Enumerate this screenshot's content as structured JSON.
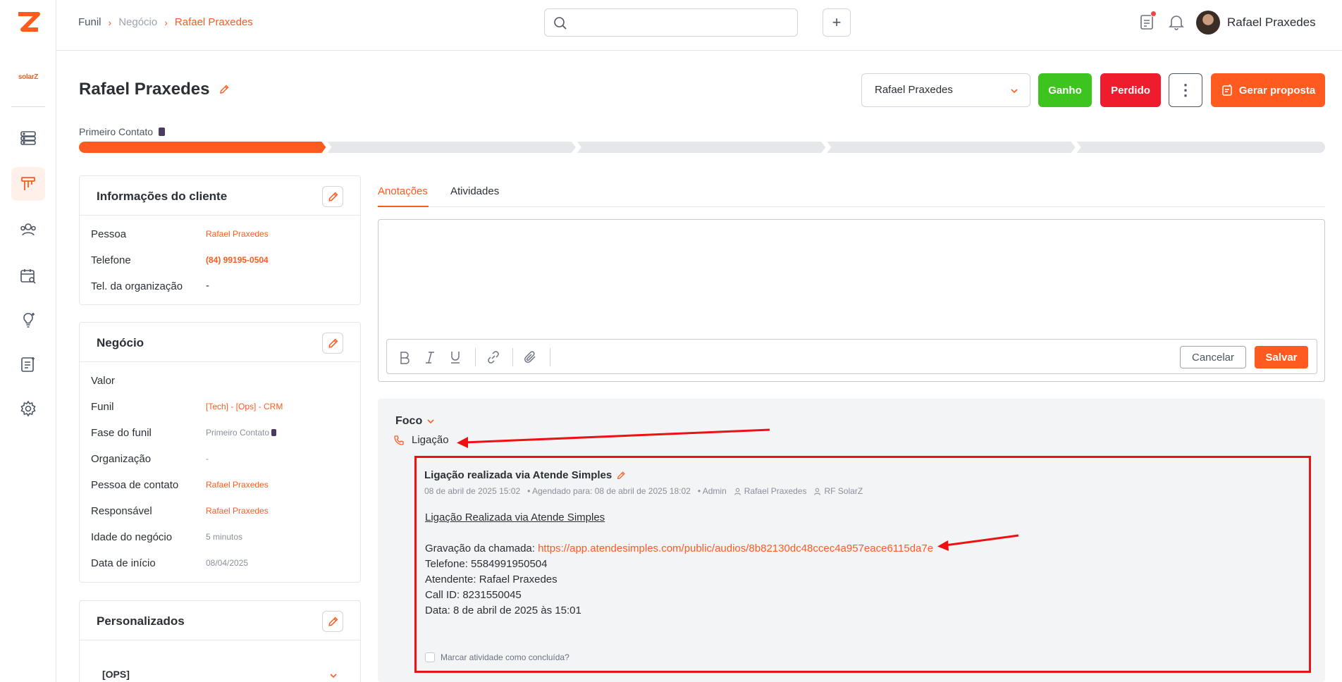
{
  "breadcrumb": {
    "items": [
      "Funil",
      "Negócio"
    ],
    "current": "Rafael Praxedes"
  },
  "search": {
    "placeholder": ""
  },
  "header": {
    "user_name": "Rafael Praxedes"
  },
  "sidebar": {
    "org_logo": "solarZ",
    "icons": [
      "servers-icon",
      "pipeline-icon",
      "users-icon",
      "calendar-search-icon",
      "lightbulb-icon",
      "notes-icon",
      "gear-icon"
    ],
    "active": "pipeline-icon"
  },
  "deal": {
    "title": "Rafael Praxedes",
    "owner": "Rafael Praxedes",
    "won_label": "Ganho",
    "lost_label": "Perdido",
    "proposal_label": "Gerar proposta",
    "stage": "Primeiro Contato",
    "pipeline_progress": {
      "completed_stages": 1,
      "total_stages": 5
    }
  },
  "client_card": {
    "title": "Informações do cliente",
    "rows": [
      {
        "label": "Pessoa",
        "value": "Rafael Praxedes"
      },
      {
        "label": "Telefone",
        "value": "(84) 99195-0504"
      },
      {
        "label": "Tel. da organização",
        "value": "-"
      }
    ]
  },
  "deal_card": {
    "title": "Negócio",
    "rows": [
      {
        "label": "Valor",
        "value": ""
      },
      {
        "label": "Funil",
        "value": "[Tech] - [Ops] - CRM"
      },
      {
        "label": "Fase do funil",
        "value": "Primeiro Contato"
      },
      {
        "label": "Organização",
        "value": "-"
      },
      {
        "label": "Pessoa de contato",
        "value": "Rafael Praxedes"
      },
      {
        "label": "Responsável",
        "value": "Rafael Praxedes"
      },
      {
        "label": "Idade do negócio",
        "value": "5 minutos"
      },
      {
        "label": "Data de início",
        "value": "08/04/2025"
      }
    ]
  },
  "custom_card": {
    "title": "Personalizados",
    "section": "[OPS]"
  },
  "tabs": [
    {
      "label": "Anotações",
      "active": true
    },
    {
      "label": "Atividades",
      "active": false
    }
  ],
  "editor": {
    "cancel_label": "Cancelar",
    "save_label": "Salvar"
  },
  "focus": {
    "title": "Foco",
    "activity_type": "Ligação",
    "activity": {
      "title": "Ligação realizada via Atende Simples",
      "date": "08 de abril de 2025 15:02",
      "scheduled": "• Agendado para: 08 de abril de 2025 18:02",
      "creator": "• Admin",
      "person": "Rafael Praxedes",
      "organization": "RF SolarZ",
      "body_heading": "Ligação Realizada via Atende Simples",
      "recording_label": "Gravação da chamada: ",
      "recording_url": "https://app.atendesimples.com/public/audios/8b82130dc48ccec4a957eace6115da7e",
      "phone_line": "Telefone: 5584991950504",
      "agent_line": "Atendente: Rafael Praxedes",
      "callid_line": "Call ID: 8231550045",
      "date_line": "Data: 8 de abril de 2025 às 15:01",
      "done_label": "Marcar atividade como concluída?"
    }
  },
  "colors": {
    "accent": "#ff5a1f",
    "won": "#3ec41e",
    "lost": "#ef1c2e",
    "annotation": "#ee1111"
  }
}
